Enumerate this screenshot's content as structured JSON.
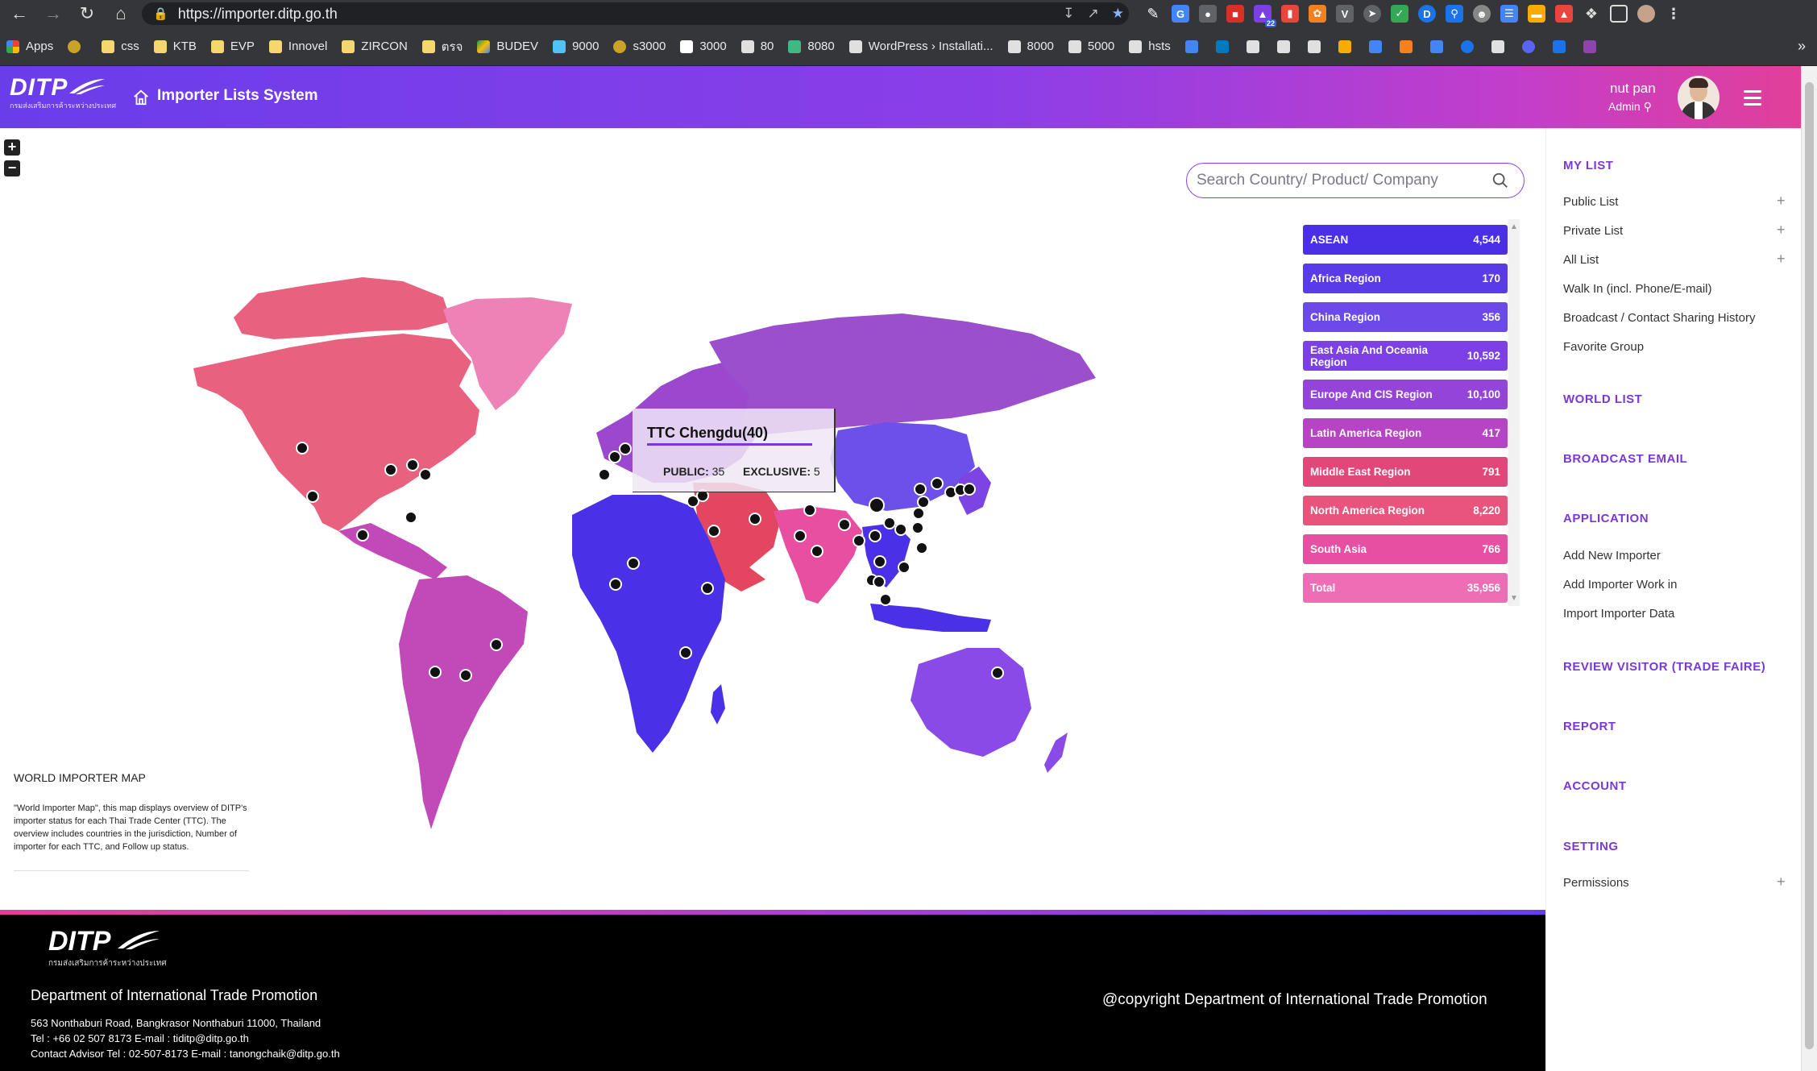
{
  "browser": {
    "url": "https://importer.ditp.go.th",
    "bookmarks": [
      "Apps",
      "css",
      "KTB",
      "EVP",
      "Innovel",
      "ZIRCON",
      "ตรจ",
      "BUDEV",
      "9000",
      "s3000",
      "3000",
      "80",
      "8080",
      "WordPress › Installati...",
      "8000",
      "5000",
      "hsts"
    ],
    "tab_count_badge": "22"
  },
  "header": {
    "logo_text": "DITP",
    "logo_sub": "กรมส่งเสริมการค้าระหว่างประเทศ",
    "title": "Importer Lists System",
    "user_name": "nut pan",
    "user_role": "Admin"
  },
  "search": {
    "placeholder": "Search Country/ Product/ Company"
  },
  "regions": [
    {
      "label": "ASEAN",
      "value": "4,544",
      "color": "#4a2fe6"
    },
    {
      "label": "Africa Region",
      "value": "170",
      "color": "#5a3be8"
    },
    {
      "label": "China Region",
      "value": "356",
      "color": "#6c4aea"
    },
    {
      "label": "East Asia And Oceania Region",
      "value": "10,592",
      "color": "#7d3fe6"
    },
    {
      "label": "Europe And CIS Region",
      "value": "10,100",
      "color": "#9444d8"
    },
    {
      "label": "Latin America Region",
      "value": "417",
      "color": "#b744c4"
    },
    {
      "label": "Middle East Region",
      "value": "791",
      "color": "#e2477a"
    },
    {
      "label": "North America Region",
      "value": "8,220",
      "color": "#e8547c"
    },
    {
      "label": "South Asia",
      "value": "766",
      "color": "#e64fa2"
    },
    {
      "label": "Total",
      "value": "35,956",
      "color": "#ee6eb6"
    }
  ],
  "tooltip": {
    "title": "TTC Chengdu(40)",
    "public_label": "PUBLIC:",
    "public_value": "35",
    "exclusive_label": "EXCLUSIVE:",
    "exclusive_value": "5"
  },
  "world_map": {
    "title": "WORLD IMPORTER MAP",
    "description": "\"World Importer Map\", this map displays overview of DITP's importer status for each Thai Trade Center (TTC). The overview includes countries in the jurisdiction, Number of importer for each TTC, and Follow up status."
  },
  "sidebar": {
    "my_list": "MY LIST",
    "public_list": "Public List",
    "private_list": "Private List",
    "all_list": "All List",
    "walk_in": "Walk In (incl. Phone/E-mail)",
    "broadcast_history": "Broadcast / Contact Sharing History",
    "favorite_group": "Favorite Group",
    "world_list": "WORLD LIST",
    "broadcast_email": "BROADCAST EMAIL",
    "application": "APPLICATION",
    "add_new_importer": "Add New Importer",
    "add_importer_work": "Add Importer Work in",
    "import_importer_data": "Import Importer Data",
    "review_visitor": "REVIEW VISITOR (TRADE FAIRE)",
    "report": "REPORT",
    "account": "ACCOUNT",
    "setting": "SETTING",
    "permissions": "Permissions"
  },
  "footer": {
    "logo_text": "DITP",
    "logo_sub": "กรมส่งเสริมการค้าระหว่างประเทศ",
    "department": "Department of International Trade Promotion",
    "address": "563 Nonthaburi Road, Bangkrasor Nonthaburi 11000, Thailand",
    "contact": "Tel : +66 02 507 8173 E-mail : tiditp@ditp.go.th",
    "advisor": "Contact Advisor Tel : 02-507-8173 E-mail : tanongchaik@ditp.go.th",
    "copyright": "@copyright Department of International Trade Promotion"
  }
}
